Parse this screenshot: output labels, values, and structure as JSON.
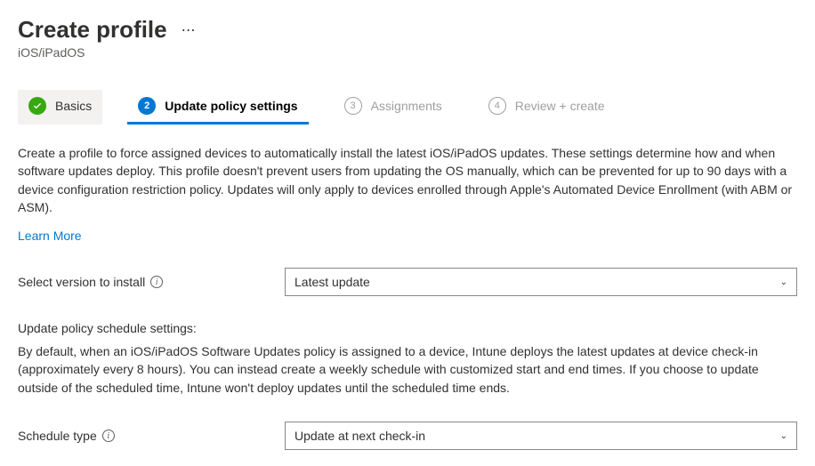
{
  "header": {
    "title": "Create profile",
    "subtitle": "iOS/iPadOS"
  },
  "tabs": [
    {
      "label": "Basics",
      "state": "completed"
    },
    {
      "label": "Update policy settings",
      "state": "active",
      "step": "2"
    },
    {
      "label": "Assignments",
      "state": "disabled",
      "step": "3"
    },
    {
      "label": "Review + create",
      "state": "disabled",
      "step": "4"
    }
  ],
  "description": "Create a profile to force assigned devices to automatically install the latest iOS/iPadOS updates. These settings determine how and when software updates deploy. This profile doesn't prevent users from updating the OS manually, which can be prevented for up to 90 days with a device configuration restriction policy. Updates will only apply to devices enrolled through Apple's Automated Device Enrollment (with ABM or ASM).",
  "learn_more": "Learn More",
  "fields": {
    "version": {
      "label": "Select version to install",
      "value": "Latest update"
    },
    "schedule_settings_label": "Update policy schedule settings:",
    "schedule_settings_desc": "By default, when an iOS/iPadOS Software Updates policy is assigned to a device, Intune deploys the latest updates at device check-in (approximately every 8 hours). You can instead create a weekly schedule with customized start and end times. If you choose to update outside of the scheduled time, Intune won't deploy updates until the scheduled time ends.",
    "schedule_type": {
      "label": "Schedule type",
      "value": "Update at next check-in"
    }
  }
}
